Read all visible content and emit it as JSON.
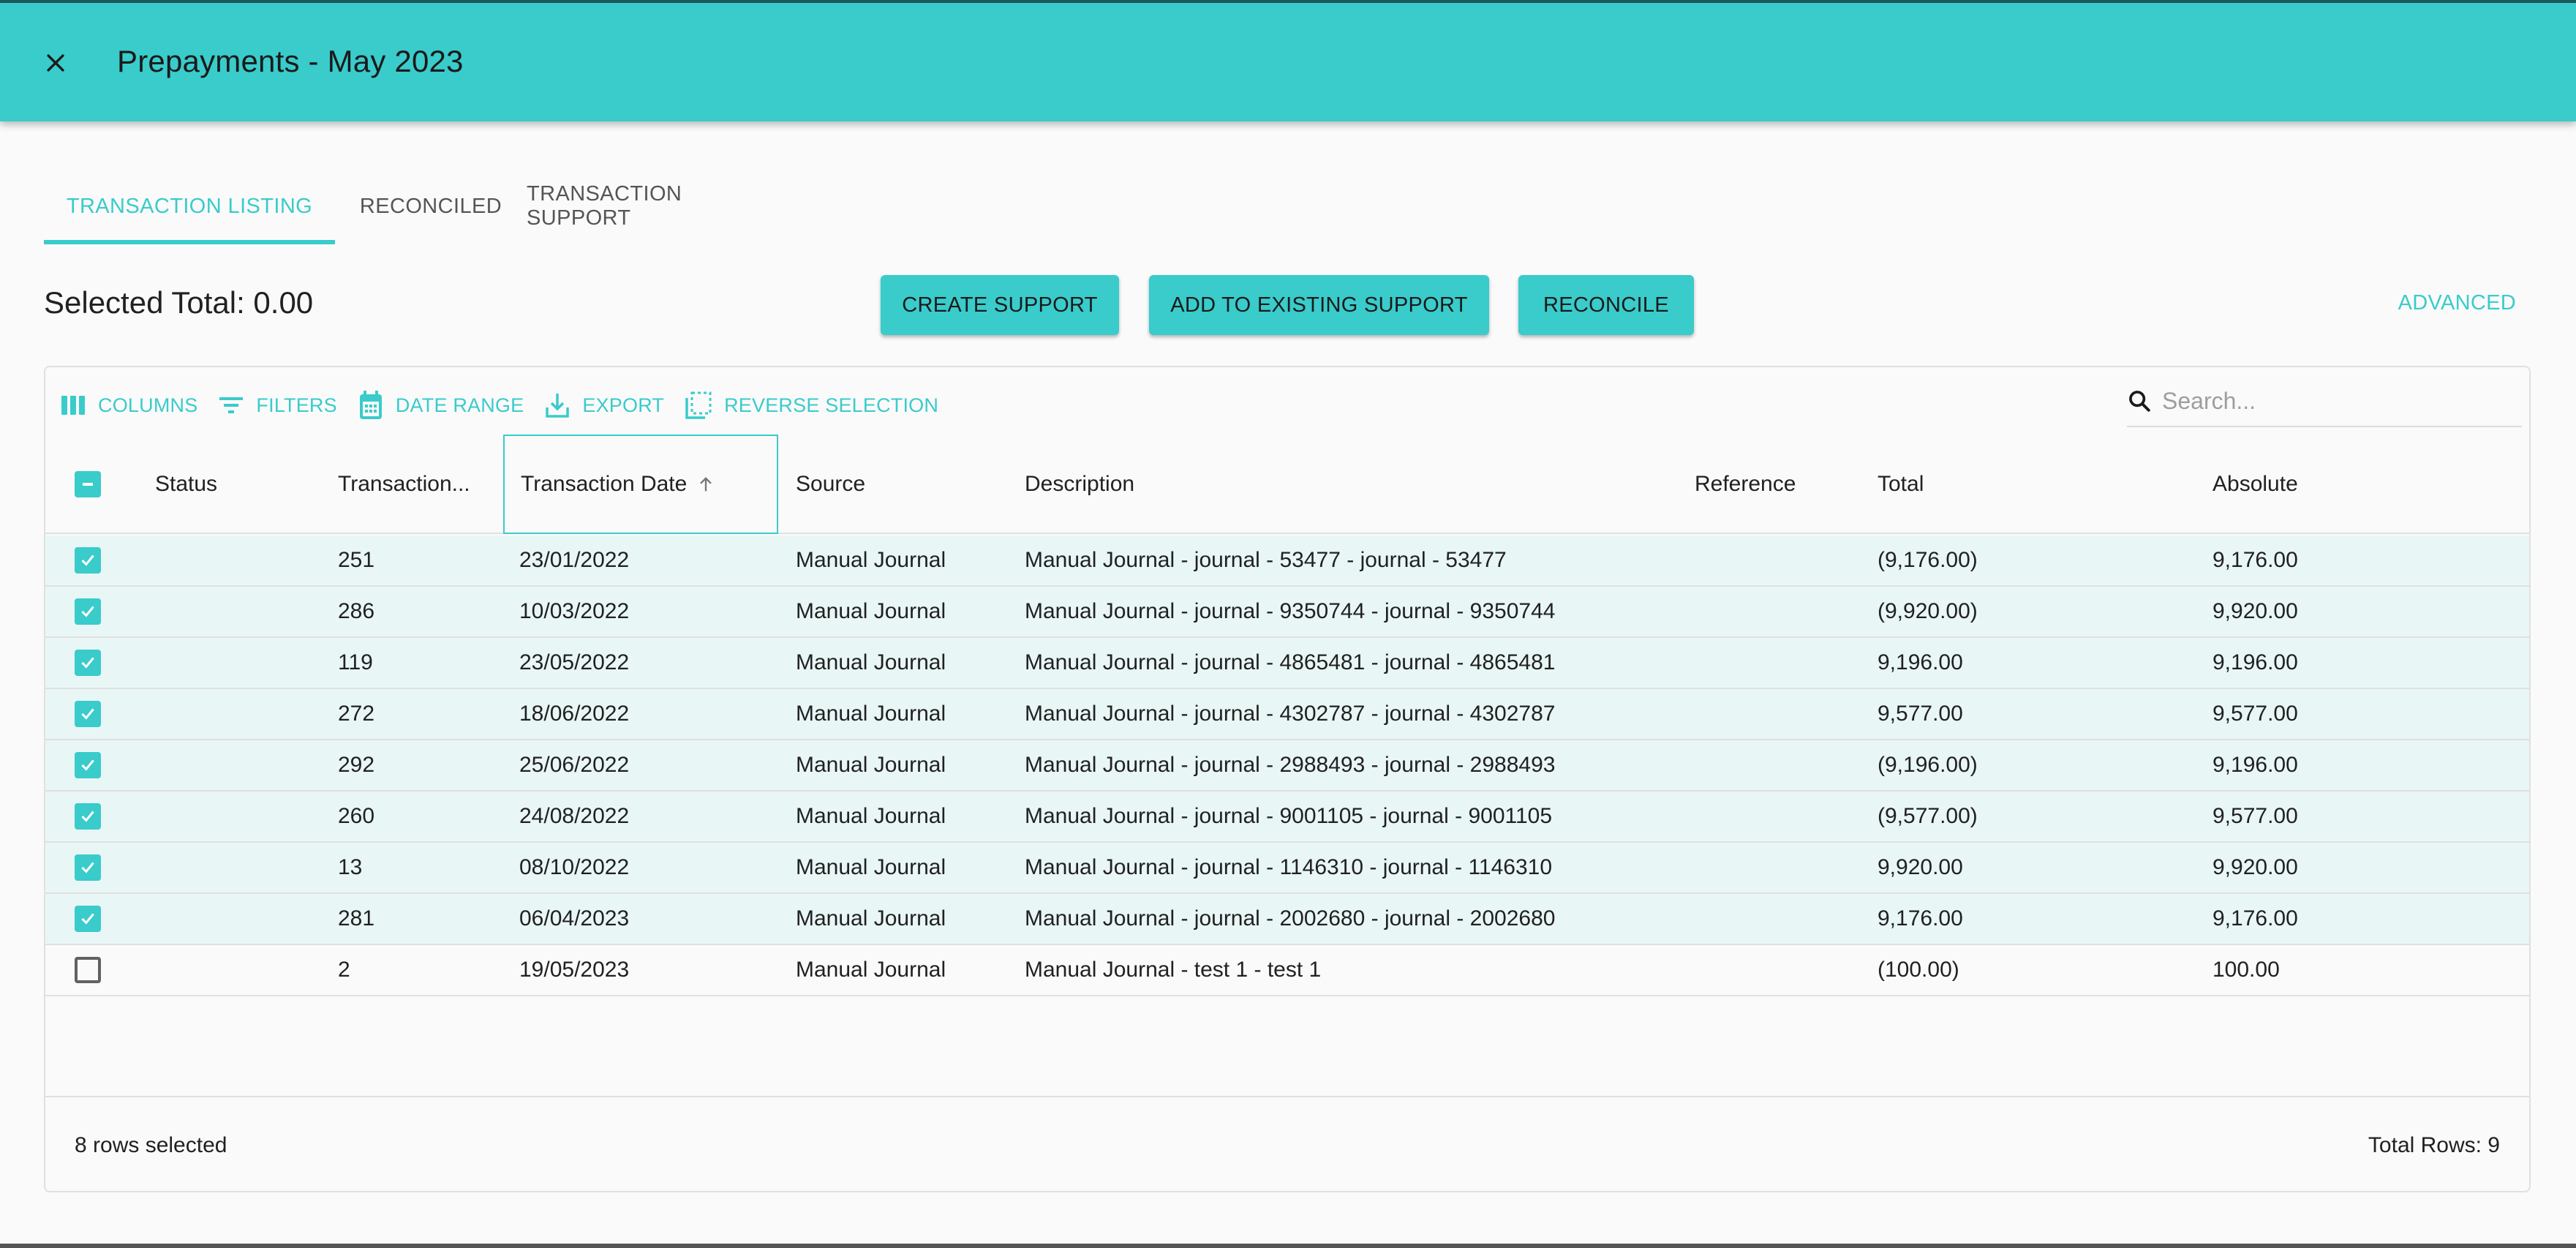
{
  "app_bar": {
    "title": "Prepayments - May 2023",
    "close_icon": "close-icon"
  },
  "tabs": [
    {
      "label": "TRANSACTION LISTING",
      "active": true
    },
    {
      "label": "RECONCILED",
      "active": false
    },
    {
      "label": "TRANSACTION SUPPORT",
      "active": false
    }
  ],
  "summary": {
    "selected_total": "Selected Total: 0.00"
  },
  "actions": {
    "create_support": "CREATE SUPPORT",
    "add_to_existing_support": "ADD TO EXISTING SUPPORT",
    "reconcile": "RECONCILE",
    "advanced": "ADVANCED"
  },
  "toolbar": {
    "columns": {
      "label": "COLUMNS",
      "icon": "columns-icon"
    },
    "filters": {
      "label": "FILTERS",
      "icon": "filter-icon"
    },
    "date_range": {
      "label": "DATE RANGE",
      "icon": "calendar-icon"
    },
    "export": {
      "label": "EXPORT",
      "icon": "download-icon"
    },
    "reverse_selection": {
      "label": "REVERSE SELECTION",
      "icon": "select-all-icon"
    },
    "search": {
      "placeholder": "Search...",
      "value": "",
      "icon": "search-icon"
    }
  },
  "table": {
    "select_all_state": "indeterminate",
    "columns": [
      {
        "key": "status",
        "label": "Status"
      },
      {
        "key": "transaction",
        "label": "Transaction..."
      },
      {
        "key": "date",
        "label": "Transaction Date",
        "sort": "ascending"
      },
      {
        "key": "source",
        "label": "Source"
      },
      {
        "key": "description",
        "label": "Description"
      },
      {
        "key": "reference",
        "label": "Reference"
      },
      {
        "key": "total",
        "label": "Total"
      },
      {
        "key": "absolute",
        "label": "Absolute"
      }
    ],
    "rows": [
      {
        "selected": true,
        "status": "",
        "transaction": "251",
        "date": "23/01/2022",
        "source": "Manual Journal",
        "description": "Manual Journal - journal - 53477 - journal - 53477",
        "reference": "",
        "total": "(9,176.00)",
        "absolute": "9,176.00"
      },
      {
        "selected": true,
        "status": "",
        "transaction": "286",
        "date": "10/03/2022",
        "source": "Manual Journal",
        "description": "Manual Journal - journal - 9350744 - journal - 9350744",
        "reference": "",
        "total": "(9,920.00)",
        "absolute": "9,920.00"
      },
      {
        "selected": true,
        "status": "",
        "transaction": "119",
        "date": "23/05/2022",
        "source": "Manual Journal",
        "description": "Manual Journal - journal - 4865481 - journal - 4865481",
        "reference": "",
        "total": "9,196.00",
        "absolute": "9,196.00"
      },
      {
        "selected": true,
        "status": "",
        "transaction": "272",
        "date": "18/06/2022",
        "source": "Manual Journal",
        "description": "Manual Journal - journal - 4302787 - journal - 4302787",
        "reference": "",
        "total": "9,577.00",
        "absolute": "9,577.00"
      },
      {
        "selected": true,
        "status": "",
        "transaction": "292",
        "date": "25/06/2022",
        "source": "Manual Journal",
        "description": "Manual Journal - journal - 2988493 - journal - 2988493",
        "reference": "",
        "total": "(9,196.00)",
        "absolute": "9,196.00"
      },
      {
        "selected": true,
        "status": "",
        "transaction": "260",
        "date": "24/08/2022",
        "source": "Manual Journal",
        "description": "Manual Journal - journal - 9001105 - journal - 9001105",
        "reference": "",
        "total": "(9,577.00)",
        "absolute": "9,577.00"
      },
      {
        "selected": true,
        "status": "",
        "transaction": "13",
        "date": "08/10/2022",
        "source": "Manual Journal",
        "description": "Manual Journal - journal - 1146310 - journal - 1146310",
        "reference": "",
        "total": "9,920.00",
        "absolute": "9,920.00"
      },
      {
        "selected": true,
        "status": "",
        "transaction": "281",
        "date": "06/04/2023",
        "source": "Manual Journal",
        "description": "Manual Journal - journal - 2002680 - journal - 2002680",
        "reference": "",
        "total": "9,176.00",
        "absolute": "9,176.00"
      },
      {
        "selected": false,
        "status": "",
        "transaction": "2",
        "date": "19/05/2023",
        "source": "Manual Journal",
        "description": "Manual Journal - test 1 - test 1",
        "reference": "",
        "total": "(100.00)",
        "absolute": "100.00"
      }
    ]
  },
  "footer": {
    "rows_selected": "8 rows selected",
    "total_rows": "Total Rows: 9"
  },
  "colors": {
    "accent": "#3acbcb",
    "selected_row": "#e9f6f6",
    "background": "#fafafa",
    "border": "#e0e0e0"
  }
}
